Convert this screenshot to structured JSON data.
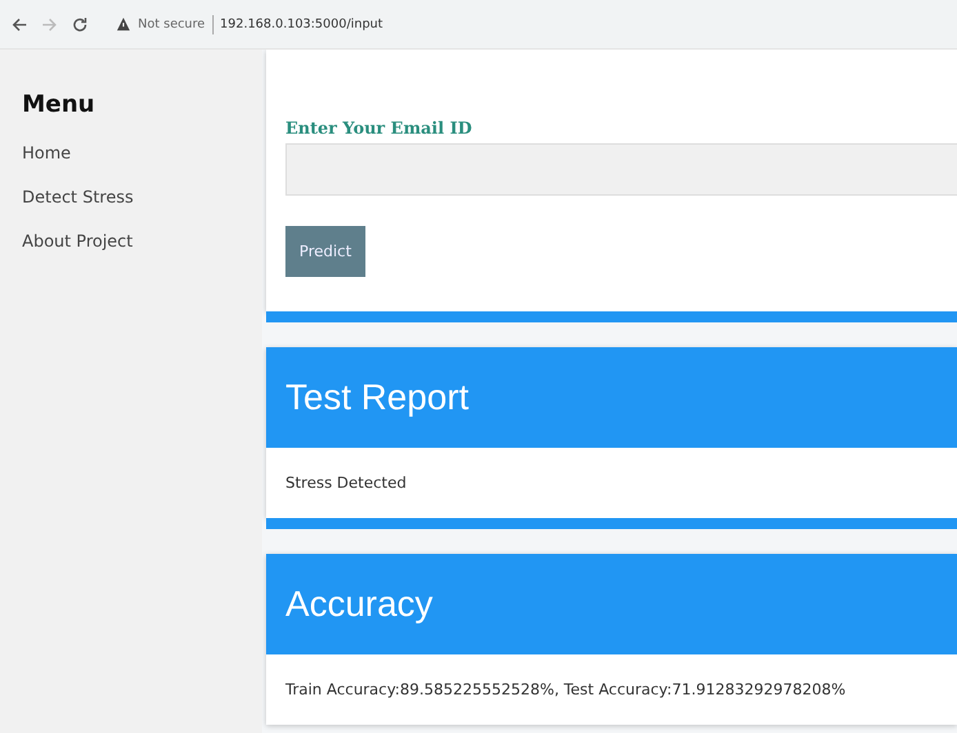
{
  "browser": {
    "security": "Not secure",
    "url": "192.168.0.103:5000/input"
  },
  "sidebar": {
    "title": "Menu",
    "items": [
      {
        "label": "Home"
      },
      {
        "label": "Detect Stress"
      },
      {
        "label": "About Project"
      }
    ]
  },
  "form": {
    "label": "Enter Your Email ID",
    "button": "Predict"
  },
  "cards": [
    {
      "title": "Test Report",
      "body": "Stress Detected",
      "footer_bar": true
    },
    {
      "title": "Accuracy",
      "body": "Train Accuracy:89.585225552528%, Test Accuracy:71.91283292978208%",
      "footer_bar": false
    }
  ]
}
